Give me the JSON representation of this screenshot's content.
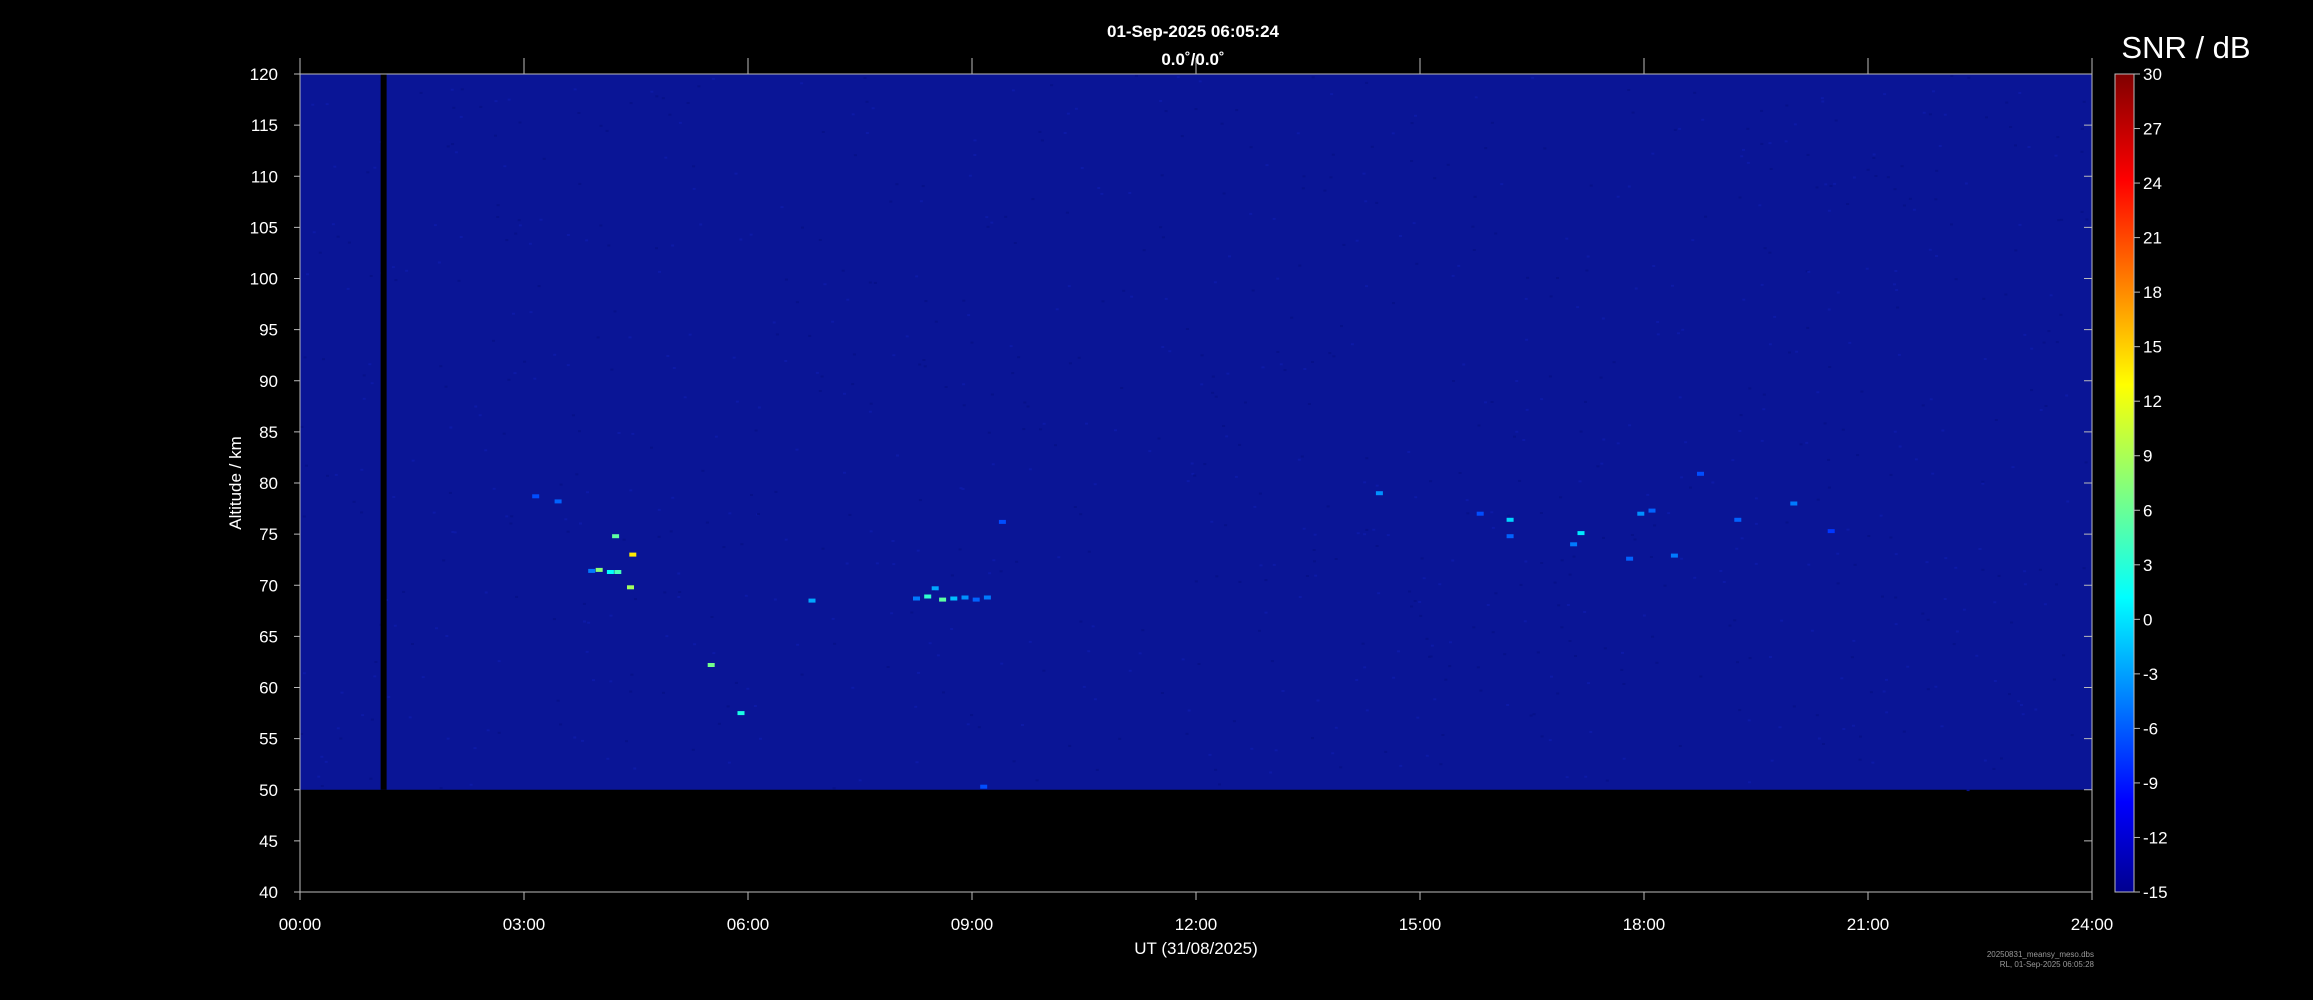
{
  "header": {
    "title": "01-Sep-2025 06:05:24",
    "subtitle": "0.0˚/0.0˚"
  },
  "colorbar": {
    "label": "SNR / dB",
    "min": -15,
    "max": 30,
    "ticks": [
      "30",
      "27",
      "24",
      "21",
      "18",
      "15",
      "12",
      "9",
      "6",
      "3",
      "0",
      "-3",
      "-6",
      "-9",
      "-12",
      "-15"
    ]
  },
  "footer": {
    "line1": "20250831_meansy_meso.dbs",
    "line2": "RL, 01-Sep-2025 06:05:28"
  },
  "chart_data": {
    "type": "heatmap",
    "title": "01-Sep-2025 06:05:24",
    "subtitle": "0.0˚/0.0˚",
    "xlabel": "UT (31/08/2025)",
    "ylabel": "Altitude / km",
    "colorbar_label": "SNR / dB",
    "x_ticks": [
      "00:00",
      "03:00",
      "06:00",
      "09:00",
      "12:00",
      "15:00",
      "18:00",
      "21:00",
      "24:00"
    ],
    "y_ticks": [
      "120",
      "115",
      "110",
      "105",
      "100",
      "95",
      "90",
      "85",
      "80",
      "75",
      "70",
      "65",
      "60",
      "55",
      "50",
      "45",
      "40"
    ],
    "xlim_hours": [
      0,
      24
    ],
    "ylim_km": [
      40,
      120
    ],
    "data_altitude_range_km": [
      50,
      120
    ],
    "background_snr_db": -13,
    "data_gap_hours": [
      1.08,
      1.16
    ],
    "echoes": [
      {
        "t": 3.15,
        "alt": 78.7,
        "snr": -6
      },
      {
        "t": 3.45,
        "alt": 78.2,
        "snr": -5
      },
      {
        "t": 3.9,
        "alt": 71.4,
        "snr": -4
      },
      {
        "t": 4.0,
        "alt": 71.5,
        "snr": 8
      },
      {
        "t": 4.15,
        "alt": 71.3,
        "snr": 2
      },
      {
        "t": 4.25,
        "alt": 71.3,
        "snr": 5
      },
      {
        "t": 4.22,
        "alt": 74.8,
        "snr": 6
      },
      {
        "t": 4.45,
        "alt": 73.0,
        "snr": 14
      },
      {
        "t": 4.42,
        "alt": 69.8,
        "snr": 9
      },
      {
        "t": 5.5,
        "alt": 62.2,
        "snr": 7
      },
      {
        "t": 5.9,
        "alt": 57.5,
        "snr": 3
      },
      {
        "t": 6.85,
        "alt": 68.5,
        "snr": -2
      },
      {
        "t": 8.25,
        "alt": 68.7,
        "snr": -4
      },
      {
        "t": 8.4,
        "alt": 68.9,
        "snr": 4
      },
      {
        "t": 8.5,
        "alt": 69.7,
        "snr": -2
      },
      {
        "t": 8.6,
        "alt": 68.6,
        "snr": 6
      },
      {
        "t": 8.75,
        "alt": 68.7,
        "snr": -1
      },
      {
        "t": 8.9,
        "alt": 68.8,
        "snr": -3
      },
      {
        "t": 9.05,
        "alt": 68.6,
        "snr": -5
      },
      {
        "t": 9.2,
        "alt": 68.8,
        "snr": -4
      },
      {
        "t": 9.4,
        "alt": 76.2,
        "snr": -6
      },
      {
        "t": 14.45,
        "alt": 79.0,
        "snr": -3
      },
      {
        "t": 15.8,
        "alt": 77.0,
        "snr": -6
      },
      {
        "t": 16.2,
        "alt": 76.4,
        "snr": 0
      },
      {
        "t": 16.2,
        "alt": 74.8,
        "snr": -5
      },
      {
        "t": 17.05,
        "alt": 74.0,
        "snr": -4
      },
      {
        "t": 17.15,
        "alt": 75.1,
        "snr": 1
      },
      {
        "t": 17.8,
        "alt": 72.6,
        "snr": -5
      },
      {
        "t": 17.95,
        "alt": 77.0,
        "snr": -3
      },
      {
        "t": 18.1,
        "alt": 77.3,
        "snr": -5
      },
      {
        "t": 18.4,
        "alt": 72.9,
        "snr": -4
      },
      {
        "t": 18.75,
        "alt": 80.9,
        "snr": -6
      },
      {
        "t": 19.25,
        "alt": 76.4,
        "snr": -5
      },
      {
        "t": 20.0,
        "alt": 78.0,
        "snr": -4
      },
      {
        "t": 20.5,
        "alt": 75.3,
        "snr": -7
      },
      {
        "t": 9.15,
        "alt": 50.3,
        "snr": -6
      }
    ]
  }
}
